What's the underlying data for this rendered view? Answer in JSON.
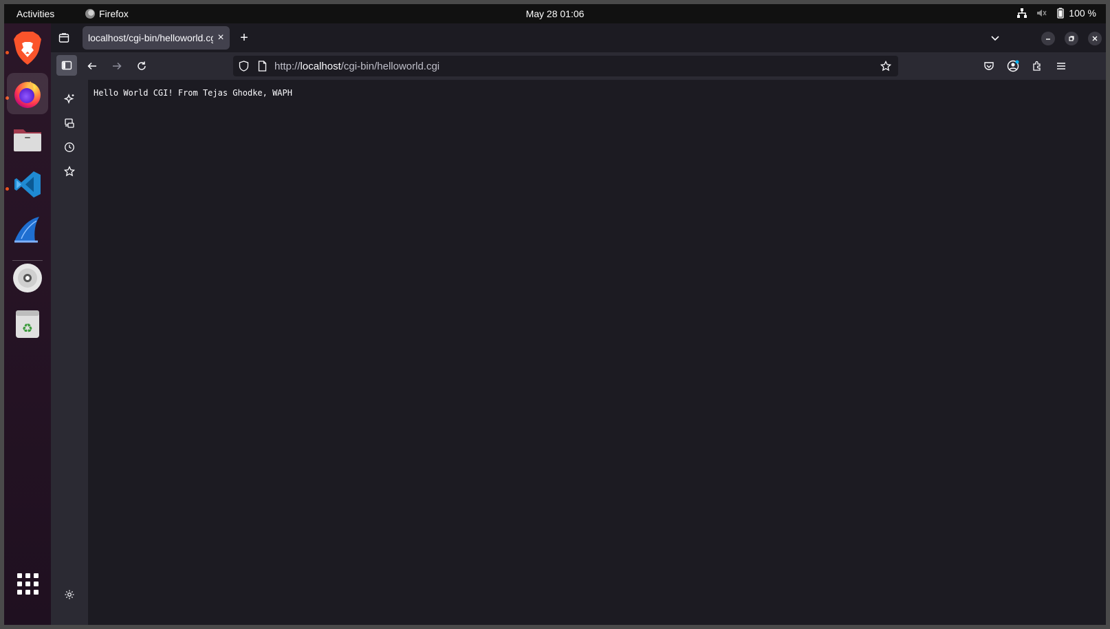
{
  "topbar": {
    "activities_label": "Activities",
    "app_name": "Firefox",
    "clock": "May 28  01:06",
    "battery_label": "100 %",
    "icons": [
      "network-icon",
      "volume-muted-icon",
      "battery-icon"
    ]
  },
  "dock": {
    "apps": [
      {
        "name": "brave-browser",
        "running": true
      },
      {
        "name": "firefox",
        "running": true,
        "active": true
      },
      {
        "name": "files",
        "running": false
      },
      {
        "name": "visual-studio-code",
        "running": true
      },
      {
        "name": "wireshark",
        "running": false
      },
      {
        "name": "optical-disc",
        "running": false
      },
      {
        "name": "trash",
        "running": false
      }
    ],
    "show_apps_icon": "app-grid-icon"
  },
  "browser": {
    "tab": {
      "title": "localhost/cgi-bin/helloworld.cgi",
      "close_label": "×"
    },
    "new_tab_label": "+",
    "url": {
      "scheme": "http://",
      "host": "localhost",
      "path": "/cgi-bin/helloworld.cgi"
    },
    "sidebar_icons": [
      "ai-chatbot-icon",
      "synced-tabs-icon",
      "history-icon",
      "bookmarks-icon",
      "settings-icon"
    ],
    "toolbar_icons": [
      "pocket-icon",
      "account-icon",
      "extensions-icon",
      "menu-icon"
    ]
  },
  "page": {
    "body_text": "Hello World CGI! From Tejas Ghodke, WAPH"
  },
  "colors": {
    "accent_orange": "#e95420",
    "toolbar": "#2b2a33",
    "content": "#1c1b22",
    "tab_active": "#42414d"
  }
}
